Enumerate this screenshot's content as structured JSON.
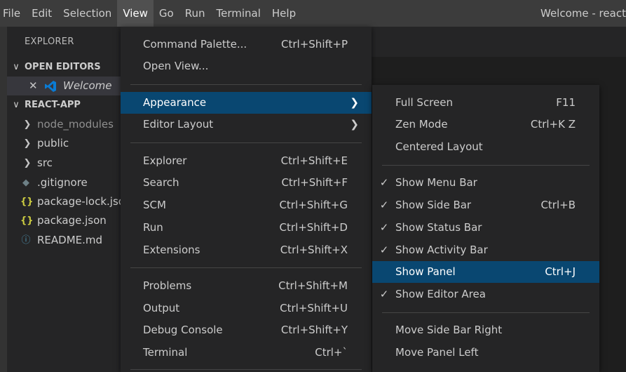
{
  "menubar": {
    "items": [
      "File",
      "Edit",
      "Selection",
      "View",
      "Go",
      "Run",
      "Terminal",
      "Help"
    ],
    "active_index": 3,
    "window_title": "Welcome - react-a"
  },
  "sidebar": {
    "title": "EXPLORER",
    "open_editors": {
      "header": "OPEN EDITORS",
      "items": [
        {
          "label": "Welcome",
          "icon": "vscode-icon"
        }
      ]
    },
    "project": {
      "header": "REACT-APP",
      "items": [
        {
          "label": "node_modules",
          "icon": "chevron-right-icon",
          "color": "#8f8f8f"
        },
        {
          "label": "public",
          "icon": "chevron-right-icon"
        },
        {
          "label": "src",
          "icon": "chevron-right-icon"
        },
        {
          "label": ".gitignore",
          "icon": "git-icon"
        },
        {
          "label": "package-lock.jso",
          "icon": "json-icon"
        },
        {
          "label": "package.json",
          "icon": "json-icon"
        },
        {
          "label": "README.md",
          "icon": "info-icon"
        }
      ]
    }
  },
  "view_menu": {
    "items": [
      {
        "label": "Command Palette...",
        "keys": "Ctrl+Shift+P"
      },
      {
        "label": "Open View...",
        "keys": ""
      },
      {
        "label": "Appearance",
        "keys": "",
        "submenu": true,
        "highlight": true
      },
      {
        "label": "Editor Layout",
        "keys": "",
        "submenu": true
      },
      {
        "label": "Explorer",
        "keys": "Ctrl+Shift+E"
      },
      {
        "label": "Search",
        "keys": "Ctrl+Shift+F"
      },
      {
        "label": "SCM",
        "keys": "Ctrl+Shift+G"
      },
      {
        "label": "Run",
        "keys": "Ctrl+Shift+D"
      },
      {
        "label": "Extensions",
        "keys": "Ctrl+Shift+X"
      },
      {
        "label": "Problems",
        "keys": "Ctrl+Shift+M"
      },
      {
        "label": "Output",
        "keys": "Ctrl+Shift+U"
      },
      {
        "label": "Debug Console",
        "keys": "Ctrl+Shift+Y"
      },
      {
        "label": "Terminal",
        "keys": "Ctrl+`"
      }
    ]
  },
  "appearance_menu": {
    "items": [
      {
        "label": "Full Screen",
        "keys": "F11",
        "checked": false
      },
      {
        "label": "Zen Mode",
        "keys": "Ctrl+K Z",
        "checked": false
      },
      {
        "label": "Centered Layout",
        "keys": "",
        "checked": false
      },
      {
        "label": "Show Menu Bar",
        "keys": "",
        "checked": true
      },
      {
        "label": "Show Side Bar",
        "keys": "Ctrl+B",
        "checked": true
      },
      {
        "label": "Show Status Bar",
        "keys": "",
        "checked": true
      },
      {
        "label": "Show Activity Bar",
        "keys": "",
        "checked": true
      },
      {
        "label": "Show Panel",
        "keys": "Ctrl+J",
        "checked": false,
        "highlight": true
      },
      {
        "label": "Show Editor Area",
        "keys": "",
        "checked": true
      },
      {
        "label": "Move Side Bar Right",
        "keys": "",
        "checked": false
      },
      {
        "label": "Move Panel Left",
        "keys": "",
        "checked": false
      }
    ]
  },
  "colors": {
    "menubar_bg": "#3c3c3c",
    "menu_bg": "#252526",
    "highlight_bg": "#094771",
    "editor_bg": "#1e1e1e",
    "json_icon": "#cbcb41",
    "vscode_blue": "#0a7bd4"
  }
}
